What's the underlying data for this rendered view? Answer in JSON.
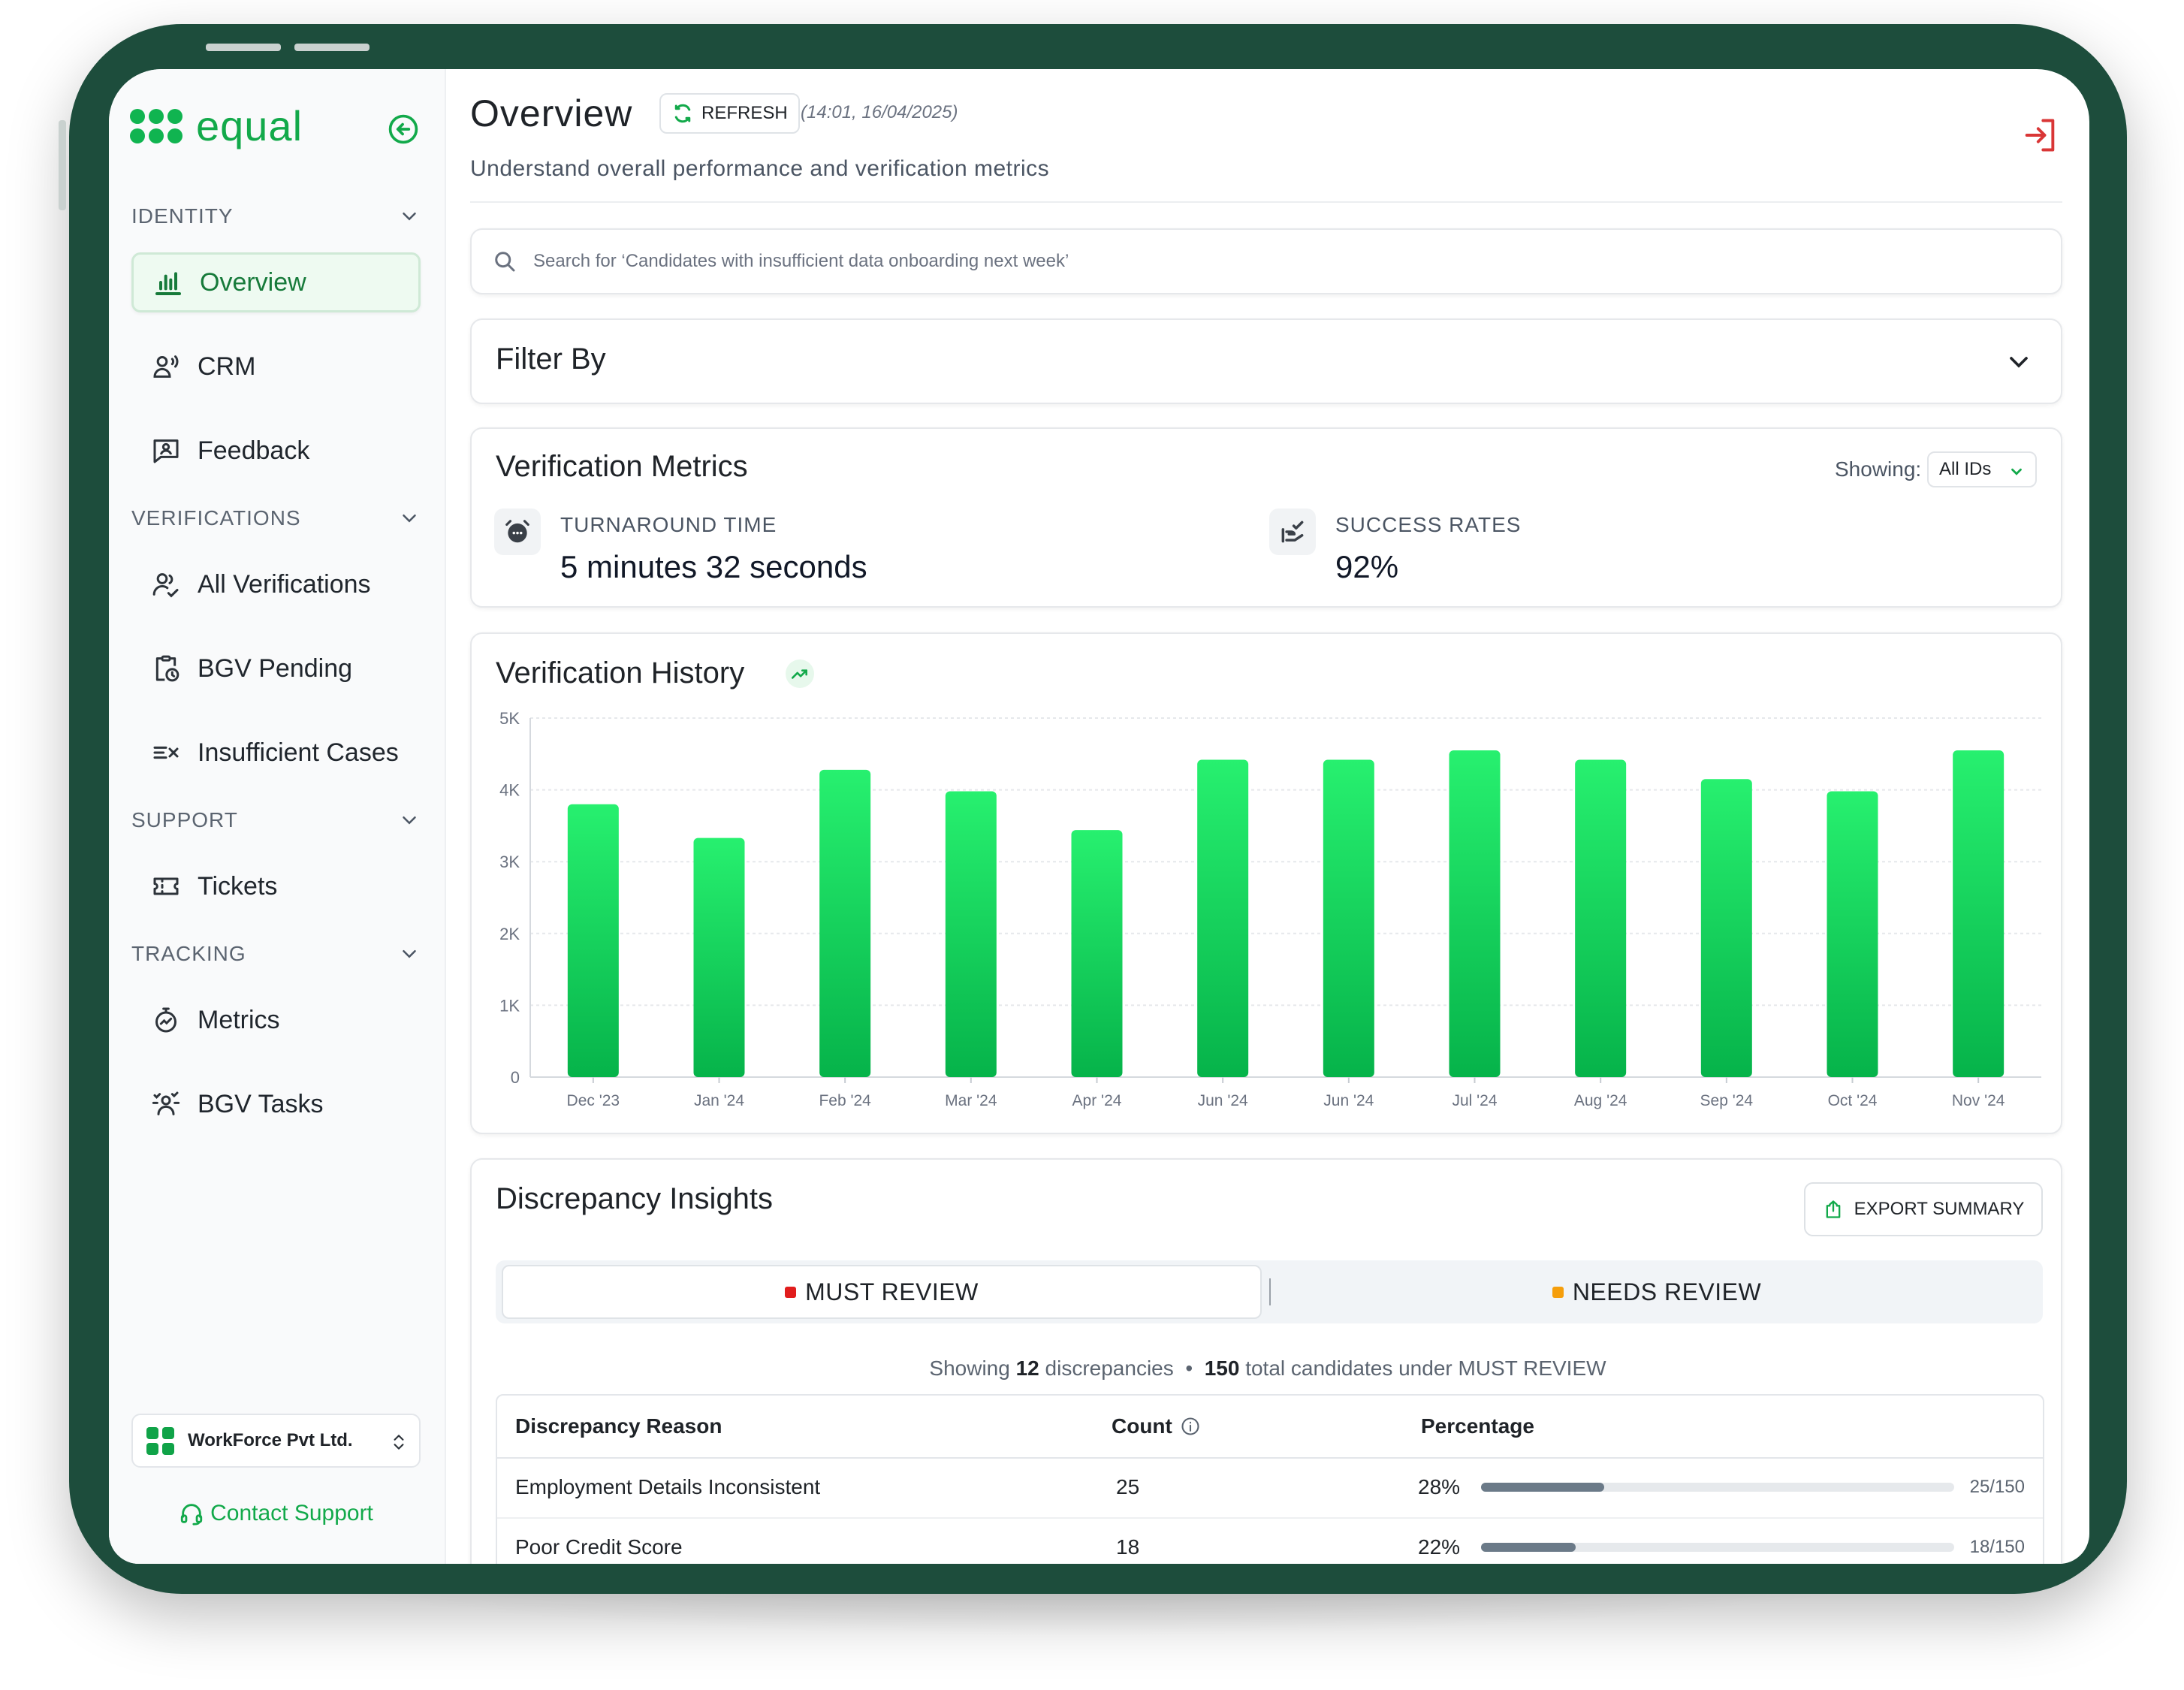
{
  "brand": {
    "name": "equal",
    "color": "#12a94a"
  },
  "sidebar": {
    "sections": [
      {
        "title": "IDENTITY",
        "items": [
          {
            "label": "Overview",
            "icon": "bar-chart-icon",
            "active": true
          },
          {
            "label": "CRM",
            "icon": "users-voice-icon"
          },
          {
            "label": "Feedback",
            "icon": "feedback-icon"
          }
        ]
      },
      {
        "title": "VERIFICATIONS",
        "items": [
          {
            "label": "All Verifications",
            "icon": "users-check-icon"
          },
          {
            "label": "BGV Pending",
            "icon": "clipboard-clock-icon"
          },
          {
            "label": "Insufficient Cases",
            "icon": "list-x-icon"
          }
        ]
      },
      {
        "title": "SUPPORT",
        "items": [
          {
            "label": "Tickets",
            "icon": "ticket-icon"
          }
        ]
      },
      {
        "title": "TRACKING",
        "items": [
          {
            "label": "Metrics",
            "icon": "stopwatch-icon"
          },
          {
            "label": "BGV Tasks",
            "icon": "tasks-icon"
          }
        ]
      }
    ],
    "org_name": "WorkForce Pvt Ltd.",
    "contact_support": "Contact Support"
  },
  "header": {
    "title": "Overview",
    "refresh_label": "REFRESH",
    "timestamp": "(14:01, 16/04/2025)",
    "subtitle": "Understand overall performance and verification metrics"
  },
  "search": {
    "placeholder": "Search for ‘Candidates with insufficient data onboarding next week’"
  },
  "filter": {
    "title": "Filter By"
  },
  "metrics": {
    "title": "Verification Metrics",
    "showing_label": "Showing:",
    "showing_value": "All IDs",
    "turnaround_label": "TURNAROUND TIME",
    "turnaround_value": "5 minutes 32 seconds",
    "success_label": "SUCCESS RATES",
    "success_value": "92%"
  },
  "history": {
    "title": "Verification History"
  },
  "chart_data": {
    "type": "bar",
    "categories": [
      "Dec '23",
      "Jan '24",
      "Feb '24",
      "Mar '24",
      "Apr '24",
      "Jun '24",
      "Jun '24",
      "Jul '24",
      "Aug '24",
      "Sep '24",
      "Oct '24",
      "Nov '24"
    ],
    "values": [
      3800,
      3330,
      4280,
      3980,
      3440,
      4420,
      4420,
      4550,
      4420,
      4150,
      3980,
      4550
    ],
    "ylim": [
      0,
      5000
    ],
    "yticks": [
      "0",
      "1K",
      "2K",
      "3K",
      "4K",
      "5K"
    ],
    "bar_color_top": "#27f06f",
    "bar_color_bottom": "#06b34a",
    "grid": true
  },
  "insights": {
    "title": "Discrepancy Insights",
    "export_label": "EXPORT SUMMARY",
    "tabs": [
      {
        "label": "MUST REVIEW",
        "color": "#e11d1d",
        "selected": true
      },
      {
        "label": "NEEDS REVIEW",
        "color": "#f59e0b",
        "selected": false
      }
    ],
    "summary": {
      "prefix": "Showing",
      "count": "12",
      "mid": "discrepancies",
      "bullet": "•",
      "total": "150",
      "suffix": "total candidates under MUST REVIEW"
    },
    "columns": [
      "Discrepancy Reason",
      "Count",
      "Percentage"
    ],
    "rows": [
      {
        "reason": "Employment Details Inconsistent",
        "count": "25",
        "percent": "28%",
        "ratio": "25/150",
        "fraction": 0.26
      },
      {
        "reason": "Poor Credit Score",
        "count": "18",
        "percent": "22%",
        "ratio": "18/150",
        "fraction": 0.2
      }
    ]
  }
}
